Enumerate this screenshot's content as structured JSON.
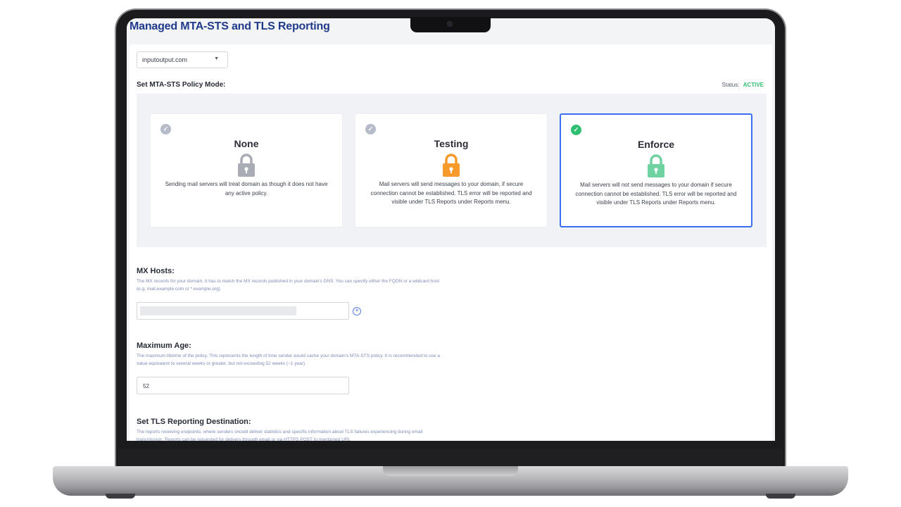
{
  "app": {
    "title": "Managed MTA-STS and TLS Reporting"
  },
  "domain_select": {
    "value": "inputoutput.com"
  },
  "policy": {
    "label": "Set MTA-STS Policy Mode:",
    "status_label": "Status:",
    "status_value": "ACTIVE",
    "modes": [
      {
        "title": "None",
        "description": "Sending mail servers will treat domain as though it does not have any active policy.",
        "lock_color": "#a9acb4",
        "selected": false
      },
      {
        "title": "Testing",
        "description": "Mail servers will send messages to your domain, if secure connection cannot be established. TLS error will be reported and visible under TLS Reports under Reports menu.",
        "lock_color": "#f79a2c",
        "selected": false
      },
      {
        "title": "Enforce",
        "description": "Mail servers will not send messages to your domain if secure connection cannot be established. TLS error will be reported and visible under TLS Reports under Reports menu.",
        "lock_color": "#6fd3a1",
        "selected": true
      }
    ]
  },
  "mx_hosts": {
    "title": "MX Hosts:",
    "help": "The MX records for your domain. It has to match the MX records published in your domain's DNS. You can specify either the FQDN or a wildcard host (e.g. mail.example.com or *.example.org)."
  },
  "max_age": {
    "title": "Maximum Age:",
    "help": "The maximum lifetime of the policy. This represents the length of time sender would cache your domain's MTA-STS policy. It is recommended to use a value equivalent to several weeks or greater, but not exceeding 52 weeks (~1 year).",
    "value": "52"
  },
  "tls_reporting": {
    "title": "Set TLS Reporting Destination:",
    "help": "The reports receiving endpoints, where senders should deliver statistics and specific information about TLS failures experiencing during email transmission. Reports can be requested for delivery through email or via HTTPS POST to mentioned URI."
  },
  "colors": {
    "accent": "#3b6ff2",
    "title_blue": "#1f3a8a",
    "active_green": "#2fbf71",
    "help_text": "#7f8bb6"
  }
}
